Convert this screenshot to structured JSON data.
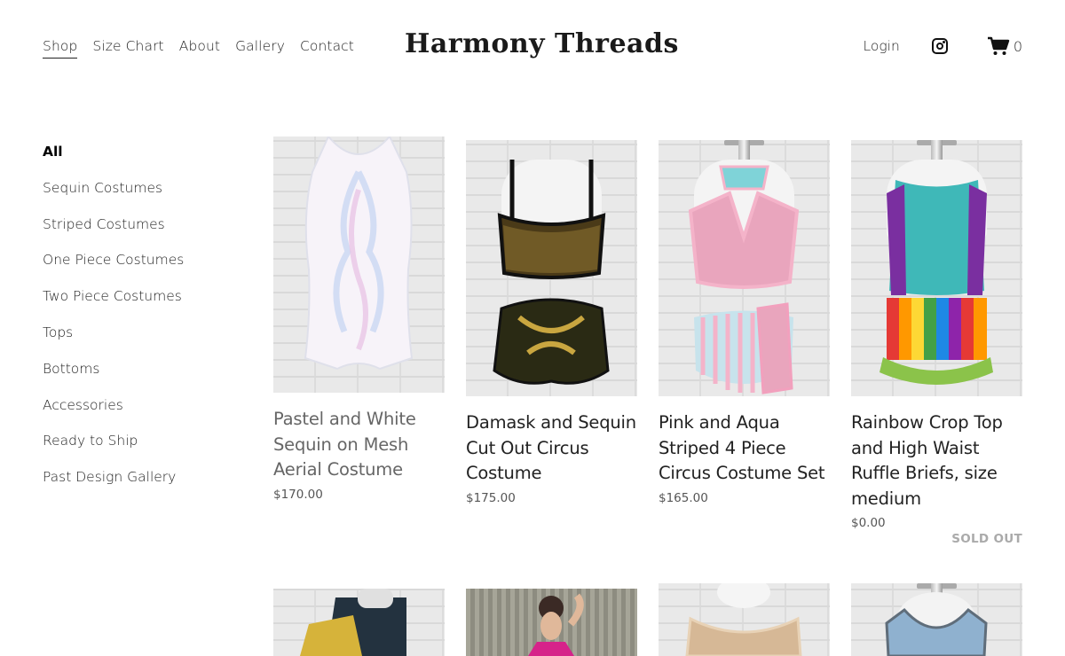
{
  "header": {
    "nav": [
      {
        "label": "Shop",
        "active": true
      },
      {
        "label": "Size Chart"
      },
      {
        "label": "About"
      },
      {
        "label": "Gallery"
      },
      {
        "label": "Contact"
      }
    ],
    "brand": "Harmony Threads",
    "login_label": "Login",
    "instagram_icon": "instagram-icon",
    "cart_icon": "shopping-cart-icon",
    "cart_count": "0"
  },
  "sidebar": {
    "categories": [
      {
        "label": "All",
        "active": true
      },
      {
        "label": "Sequin Costumes"
      },
      {
        "label": "Striped Costumes"
      },
      {
        "label": "One Piece Costumes"
      },
      {
        "label": "Two Piece Costumes"
      },
      {
        "label": "Tops"
      },
      {
        "label": "Bottoms"
      },
      {
        "label": "Accessories"
      },
      {
        "label": "Ready to Ship"
      },
      {
        "label": "Past Design Gallery"
      }
    ]
  },
  "products": [
    {
      "title": "Pastel and White Sequin on Mesh Aerial Costume",
      "price": "$170.00"
    },
    {
      "title": "Damask and Sequin Cut Out Circus Costume",
      "price": "$175.00"
    },
    {
      "title": "Pink and Aqua Striped 4 Piece Circus Costume Set",
      "price": "$165.00"
    },
    {
      "title": "Rainbow Crop Top and High Waist Ruffle Briefs, size medium",
      "price": "$0.00",
      "badge": "SOLD OUT"
    }
  ],
  "colors": {
    "text": "#222222",
    "muted": "#555555",
    "sold_out": "#aaaaaa",
    "background": "#ffffff"
  }
}
